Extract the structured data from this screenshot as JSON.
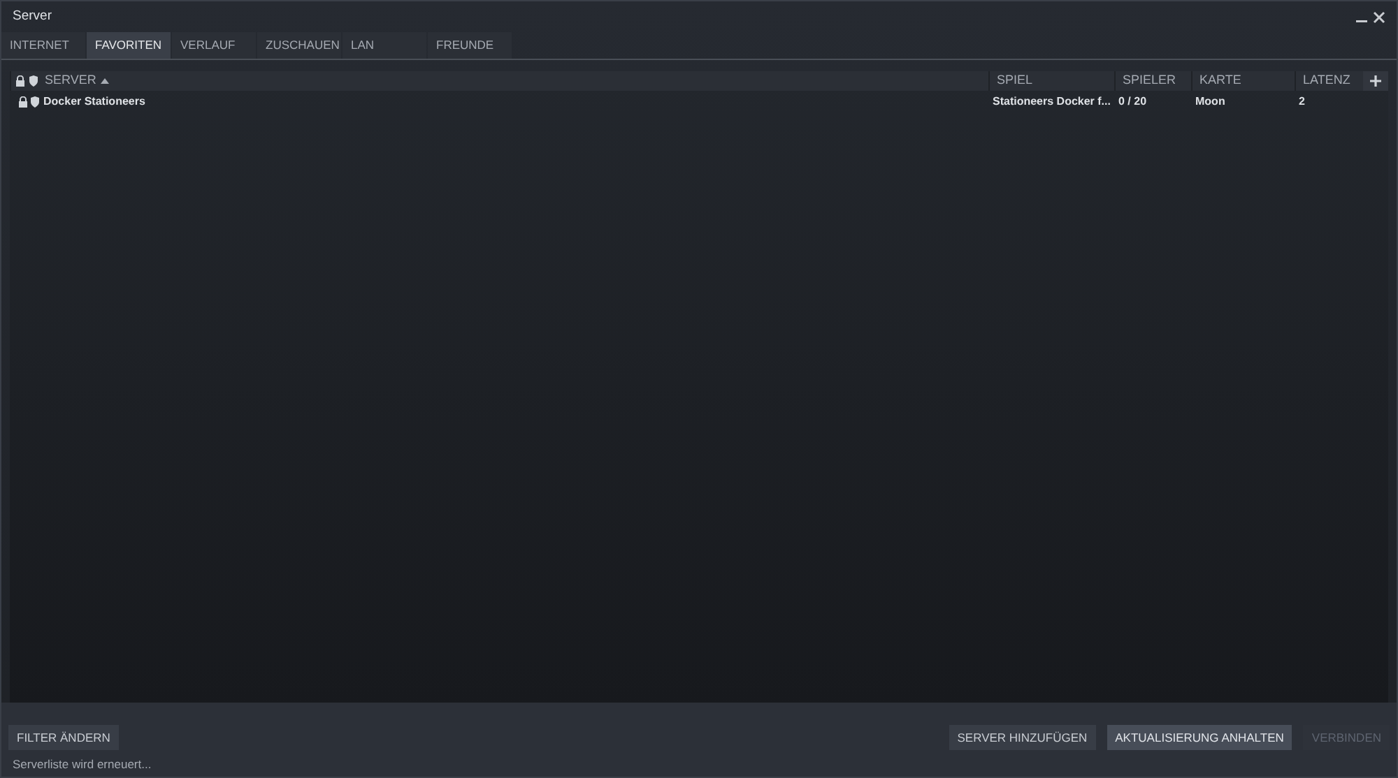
{
  "window": {
    "title": "Server"
  },
  "tabs": [
    {
      "label": "INTERNET",
      "selected": false
    },
    {
      "label": "FAVORITEN",
      "selected": true
    },
    {
      "label": "VERLAUF",
      "selected": false
    },
    {
      "label": "ZUSCHAUEN",
      "selected": false
    },
    {
      "label": "LAN",
      "selected": false
    },
    {
      "label": "FREUNDE",
      "selected": false
    }
  ],
  "columns": [
    {
      "label": "SERVER",
      "sorted": true
    },
    {
      "label": "SPIEL",
      "sorted": false
    },
    {
      "label": "SPIELER",
      "sorted": false
    },
    {
      "label": "KARTE",
      "sorted": false
    },
    {
      "label": "LATENZ",
      "sorted": false
    }
  ],
  "rows": [
    {
      "password": true,
      "secure": true,
      "cells": [
        "Docker Stationeers",
        "Stationeers Docker f...",
        "0 / 20",
        "Moon",
        "2"
      ]
    }
  ],
  "buttons_left": [
    {
      "label": "FILTER ÄNDERN",
      "disabled": false
    }
  ],
  "buttons_right": [
    {
      "label": "SERVER HINZUFÜGEN",
      "disabled": false,
      "selected": false
    },
    {
      "label": "AKTUALISIERUNG ANHALTEN",
      "disabled": false,
      "selected": true
    },
    {
      "label": "VERBINDEN",
      "disabled": true,
      "selected": false
    }
  ],
  "status_bar": "Serverliste wird erneuert..."
}
